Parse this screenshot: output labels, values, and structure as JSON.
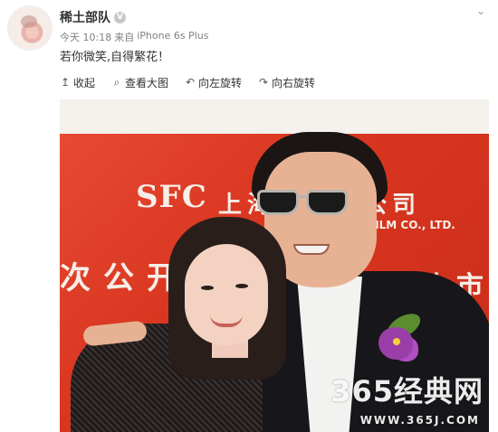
{
  "post": {
    "username": "稀土部队",
    "verified_icon": "v-badge-icon",
    "time": "今天 10:18",
    "source_prefix": "来自",
    "device": "iPhone 6s Plus",
    "text": "若你微笑,自得繁花！",
    "menu_icon": "chevron-down-icon"
  },
  "toolbar": {
    "items": [
      {
        "icon": "collapse-up-icon",
        "glyph": "↥",
        "label": "收起"
      },
      {
        "icon": "magnifier-icon",
        "glyph": "⌕",
        "label": "查看大图"
      },
      {
        "icon": "rotate-left-icon",
        "glyph": "↶",
        "label": "向左旋转"
      },
      {
        "icon": "rotate-right-icon",
        "glyph": "↷",
        "label": "向右旋转"
      }
    ]
  },
  "photo": {
    "backdrop_logo": "SFC",
    "backdrop_cn": "上海…有限公司",
    "backdrop_en": "FILM CO., LTD.",
    "backdrop_banner": "次公开",
    "backdrop_banner_right": "上市",
    "watermark_main": "365经典网",
    "watermark_url": "WWW.365J.COM"
  },
  "colors": {
    "backdrop_red": "#d9351f",
    "text_primary": "#333333",
    "text_meta": "#808080"
  }
}
